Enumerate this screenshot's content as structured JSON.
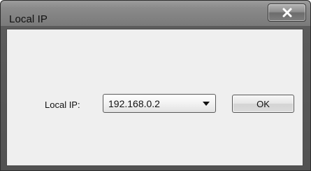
{
  "window": {
    "title": "Local IP",
    "close_icon": "close-icon"
  },
  "form": {
    "ip_label": "Local IP:",
    "ip_selected": "192.168.0.2",
    "ok_label": "OK"
  },
  "colors": {
    "frame": "#5c5c5c",
    "client": "#efefef"
  }
}
